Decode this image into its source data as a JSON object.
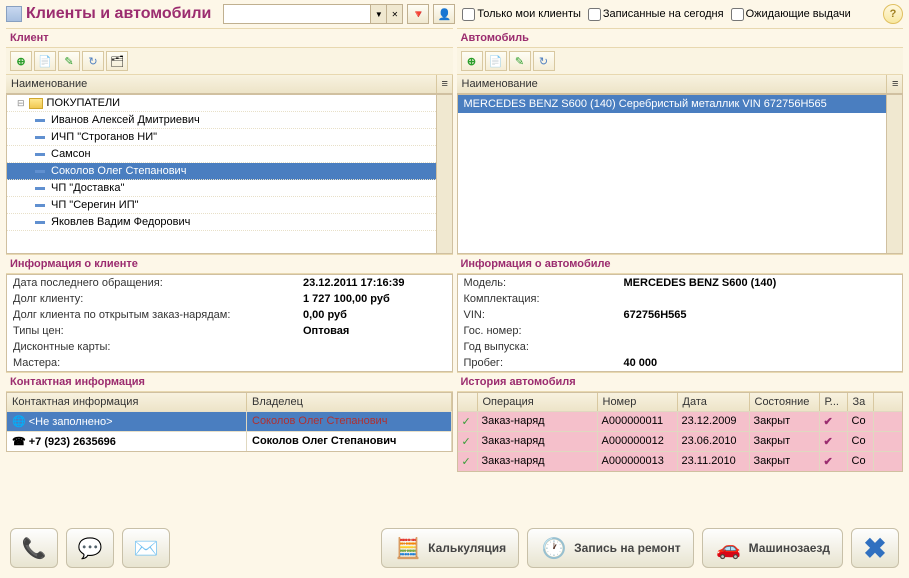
{
  "title": "Клиенты и автомобили",
  "filters": {
    "only_my": "Только мои клиенты",
    "today": "Записанные на сегодня",
    "waiting": "Ожидающие выдачи"
  },
  "client": {
    "header": "Клиент",
    "column": "Наименование",
    "folder": "ПОКУПАТЕЛИ",
    "items": [
      "Иванов Алексей Дмитриевич",
      "ИЧП \"Строганов НИ\"",
      "Самсон",
      "Соколов Олег Степанович",
      "ЧП \"Доставка\"",
      "ЧП \"Серегин ИП\"",
      "Яковлев  Вадим  Федорович"
    ],
    "selected_index": 3
  },
  "client_info": {
    "header": "Информация о клиенте",
    "rows": [
      {
        "label": "Дата последнего обращения:",
        "value": "23.12.2011 17:16:39"
      },
      {
        "label": "Долг клиенту:",
        "value": "1 727 100,00 руб"
      },
      {
        "label": "Долг клиента по открытым заказ-нарядам:",
        "value": "0,00 руб"
      },
      {
        "label": "Типы цен:",
        "value": "Оптовая"
      },
      {
        "label": "Дисконтные карты:",
        "value": ""
      },
      {
        "label": "Мастера:",
        "value": ""
      }
    ]
  },
  "contact": {
    "header": "Контактная информация",
    "col1": "Контактная информация",
    "col2": "Владелец",
    "rows": [
      {
        "info": "<Не заполнено>",
        "owner": "Соколов Олег Степанович",
        "selected": true,
        "owner_red": true
      },
      {
        "info": "+7 (923) 2635696",
        "owner": "Соколов Олег Степанович",
        "bold": true
      }
    ]
  },
  "auto": {
    "header": "Автомобиль",
    "column": "Наименование",
    "items": [
      "MERCEDES BENZ S600 (140) Серебристый металлик VIN 672756H565"
    ]
  },
  "auto_info": {
    "header": "Информация о автомобиле",
    "rows": [
      {
        "label": "Модель:",
        "value": "MERCEDES BENZ S600 (140)"
      },
      {
        "label": "Комплектация:",
        "value": ""
      },
      {
        "label": "VIN:",
        "value": "672756H565"
      },
      {
        "label": "Гос. номер:",
        "value": ""
      },
      {
        "label": "Год выпуска:",
        "value": ""
      },
      {
        "label": "Пробег:",
        "value": "40 000"
      }
    ]
  },
  "history": {
    "header": "История автомобиля",
    "cols": [
      "",
      "Операция",
      "Номер",
      "Дата",
      "Состояние",
      "Р...",
      "За"
    ],
    "rows": [
      {
        "op": "Заказ-наряд",
        "num": "А000000011",
        "date": "23.12.2009",
        "state": "Закрыт",
        "r": "✔",
        "z": "Со"
      },
      {
        "op": "Заказ-наряд",
        "num": "А000000012",
        "date": "23.06.2010",
        "state": "Закрыт",
        "r": "✔",
        "z": "Со"
      },
      {
        "op": "Заказ-наряд",
        "num": "А000000013",
        "date": "23.11.2010",
        "state": "Закрыт",
        "r": "✔",
        "z": "Со"
      }
    ]
  },
  "footer": {
    "calc": "Калькуляция",
    "repair": "Запись на ремонт",
    "entry": "Машинозаезд"
  }
}
